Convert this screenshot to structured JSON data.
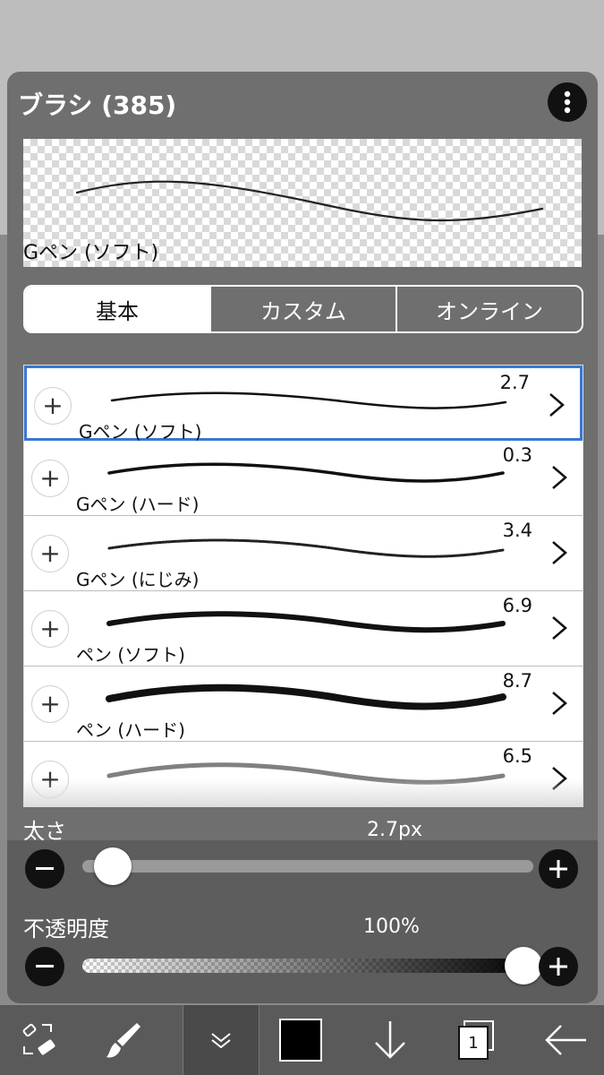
{
  "panel": {
    "title": "ブラシ (385)",
    "preview_label": "Gペン (ソフト)"
  },
  "tabs": [
    {
      "label": "基本",
      "active": true
    },
    {
      "label": "カスタム",
      "active": false
    },
    {
      "label": "オンライン",
      "active": false
    }
  ],
  "brushes": [
    {
      "name": "Gペン (ソフト)",
      "size": "2.7",
      "selected": true
    },
    {
      "name": "Gペン (ハード)",
      "size": "0.3",
      "selected": false
    },
    {
      "name": "Gペン (にじみ)",
      "size": "3.4",
      "selected": false
    },
    {
      "name": "ペン (ソフト)",
      "size": "6.9",
      "selected": false
    },
    {
      "name": "ペン (ハード)",
      "size": "8.7",
      "selected": false
    },
    {
      "name": "",
      "size": "6.5",
      "selected": false
    }
  ],
  "thickness": {
    "label": "太さ",
    "value": "2.7px",
    "slider_fraction": 0.05
  },
  "opacity": {
    "label": "不透明度",
    "value": "100%",
    "slider_fraction": 1.0
  },
  "toolbar": {
    "layer_count": "1",
    "color": "#000000"
  }
}
